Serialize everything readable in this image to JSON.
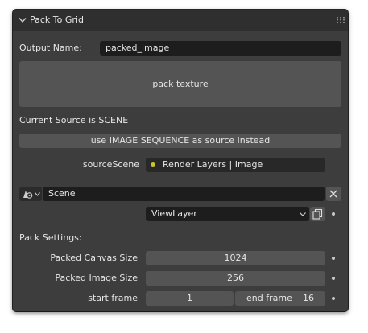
{
  "panel": {
    "title": "Pack To Grid",
    "output_name_label": "Output Name:",
    "output_name_value": "packed_image",
    "pack_button": "pack texture",
    "current_source": "Current Source is SCENE",
    "switch_source_button": "use IMAGE SEQUENCE as source instead",
    "source_scene_label": "sourceScene",
    "source_scene_value": "Render Layers | Image",
    "scene_value": "Scene",
    "view_layer_value": "ViewLayer",
    "pack_settings_label": "Pack Settings:",
    "canvas_size_label": "Packed Canvas Size",
    "canvas_size_value": "1024",
    "image_size_label": "Packed Image Size",
    "image_size_value": "256",
    "start_frame_label": "start frame",
    "start_frame_value": "1",
    "end_frame_label": "end frame",
    "end_frame_value": "16"
  },
  "colors": {
    "panel_bg": "#3d3d3d",
    "header_bg": "#2f2f2f",
    "field_bg": "#1d1d1d",
    "button_bg": "#545454",
    "socket_yellow": "#c7c729"
  },
  "icons": {
    "collapse": "chevron-down-icon",
    "grip": "drag-handle-icon",
    "scene_selector": "scene-icon",
    "clear": "close-icon",
    "new_view_layer": "duplicate-icon",
    "socket": "socket-dot-icon"
  }
}
